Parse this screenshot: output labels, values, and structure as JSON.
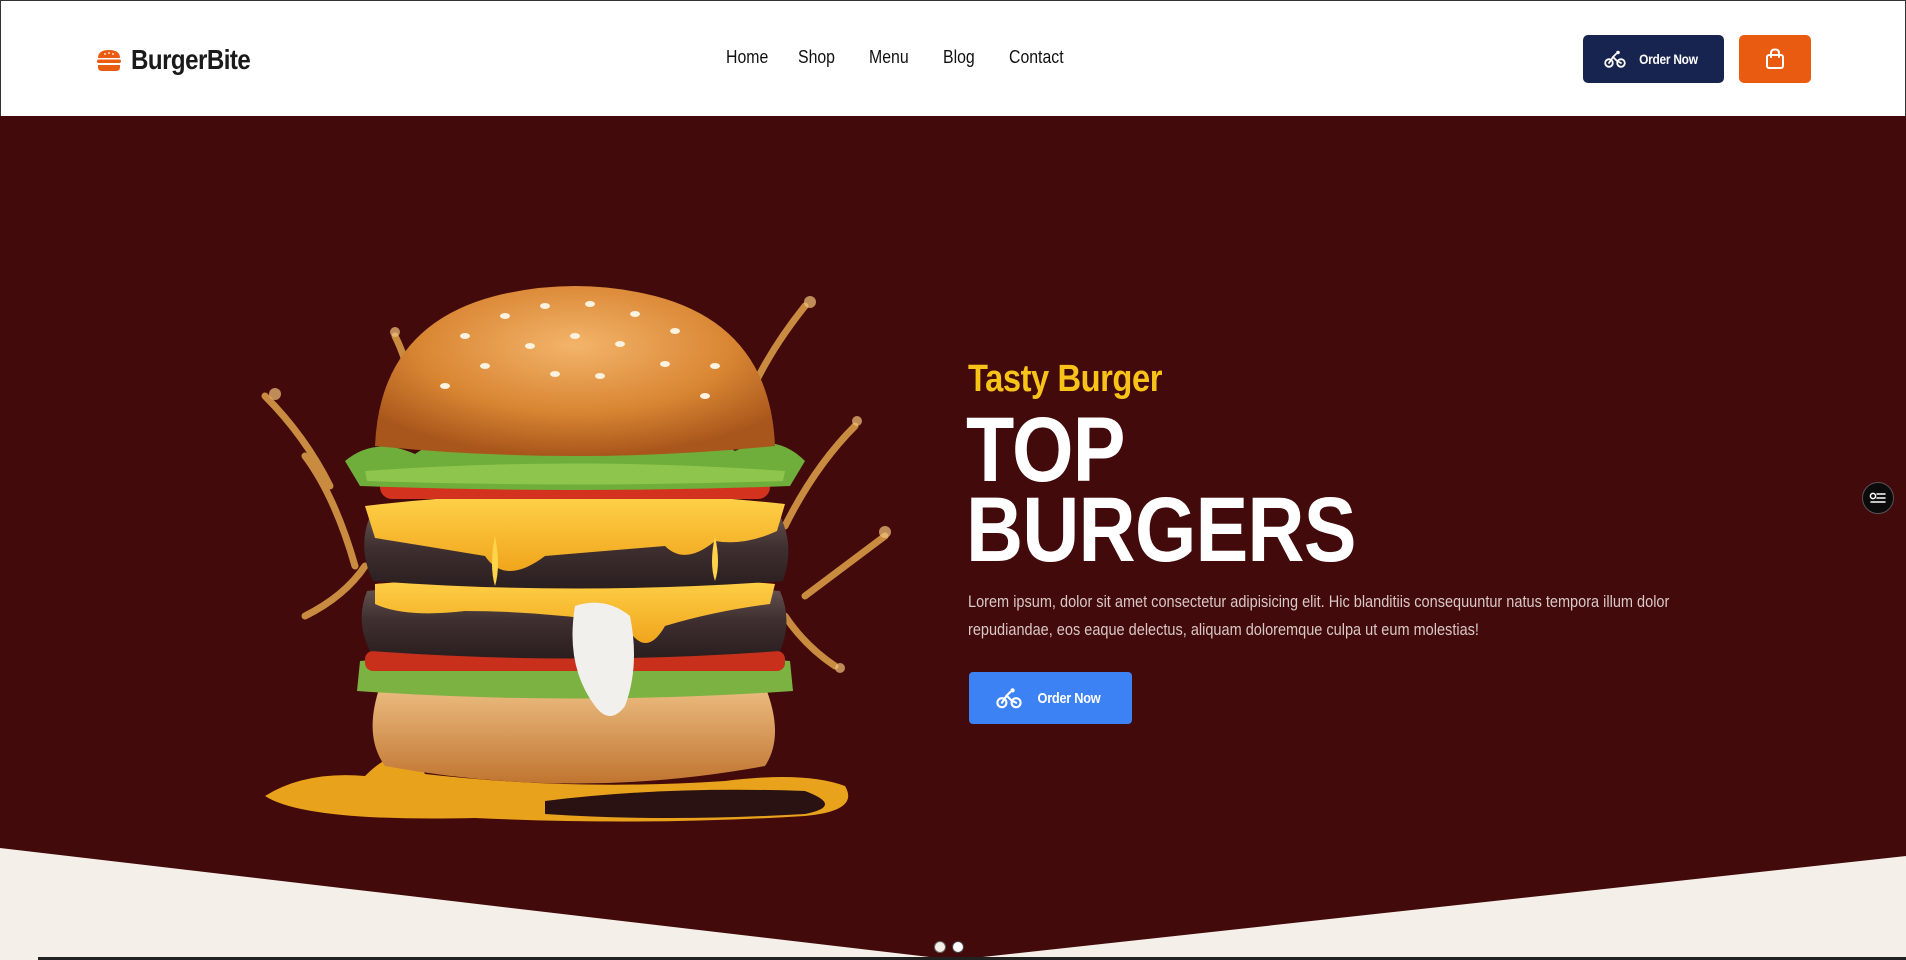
{
  "brand": {
    "name": "BurgerBite"
  },
  "nav": {
    "items": [
      {
        "label": "Home"
      },
      {
        "label": "Shop"
      },
      {
        "label": "Menu"
      },
      {
        "label": "Blog"
      },
      {
        "label": "Contact"
      }
    ]
  },
  "header_actions": {
    "order_label": "Order Now",
    "cart_icon": "shopping-bag-icon"
  },
  "hero": {
    "subtitle": "Tasty Burger",
    "headline_line1": "TOP",
    "headline_line2": "BURGERS",
    "description": "Lorem ipsum, dolor sit amet consectetur adipisicing elit. Hic blanditiis consequuntur natus tempora illum dolor repudiandae, eos eaque delectus, aliquam doloremque culpa ut eum molestias!",
    "cta_label": "Order Now",
    "image": "burger-splash-image"
  },
  "slider": {
    "dots": 2,
    "active": 1
  },
  "colors": {
    "hero_bg": "#430a0b",
    "accent_yellow": "#f7c318",
    "brand_orange": "#ea5b12",
    "navy": "#16244f",
    "cta_blue": "#3d82f5",
    "page_bg": "#f4efe9"
  }
}
